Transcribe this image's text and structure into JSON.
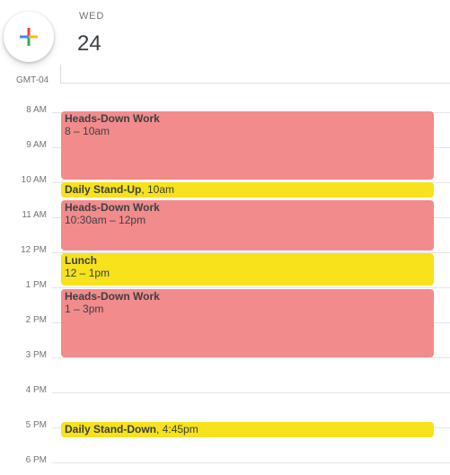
{
  "header": {
    "day_name": "WED",
    "day_number": "24",
    "timezone": "GMT-04",
    "create_icon": "plus-icon"
  },
  "hours": [
    "8 AM",
    "9 AM",
    "10 AM",
    "11 AM",
    "12 PM",
    "1 PM",
    "2 PM",
    "3 PM",
    "4 PM",
    "5 PM",
    "6 PM"
  ],
  "events": [
    {
      "title": "Heads-Down Work",
      "time": "8 – 10am",
      "color": "#f28b8b"
    },
    {
      "title": "Daily Stand-Up",
      "time": ", 10am",
      "color": "#f7e21b"
    },
    {
      "title": "Heads-Down Work",
      "time": "10:30am – 12pm",
      "color": "#f28b8b"
    },
    {
      "title": "Lunch",
      "time": "12 – 1pm",
      "color": "#f7e21b"
    },
    {
      "title": "Heads-Down Work",
      "time": "1 – 3pm",
      "color": "#f28b8b"
    },
    {
      "title": "Daily Stand-Down",
      "time": ", 4:45pm",
      "color": "#f7e21b"
    }
  ]
}
